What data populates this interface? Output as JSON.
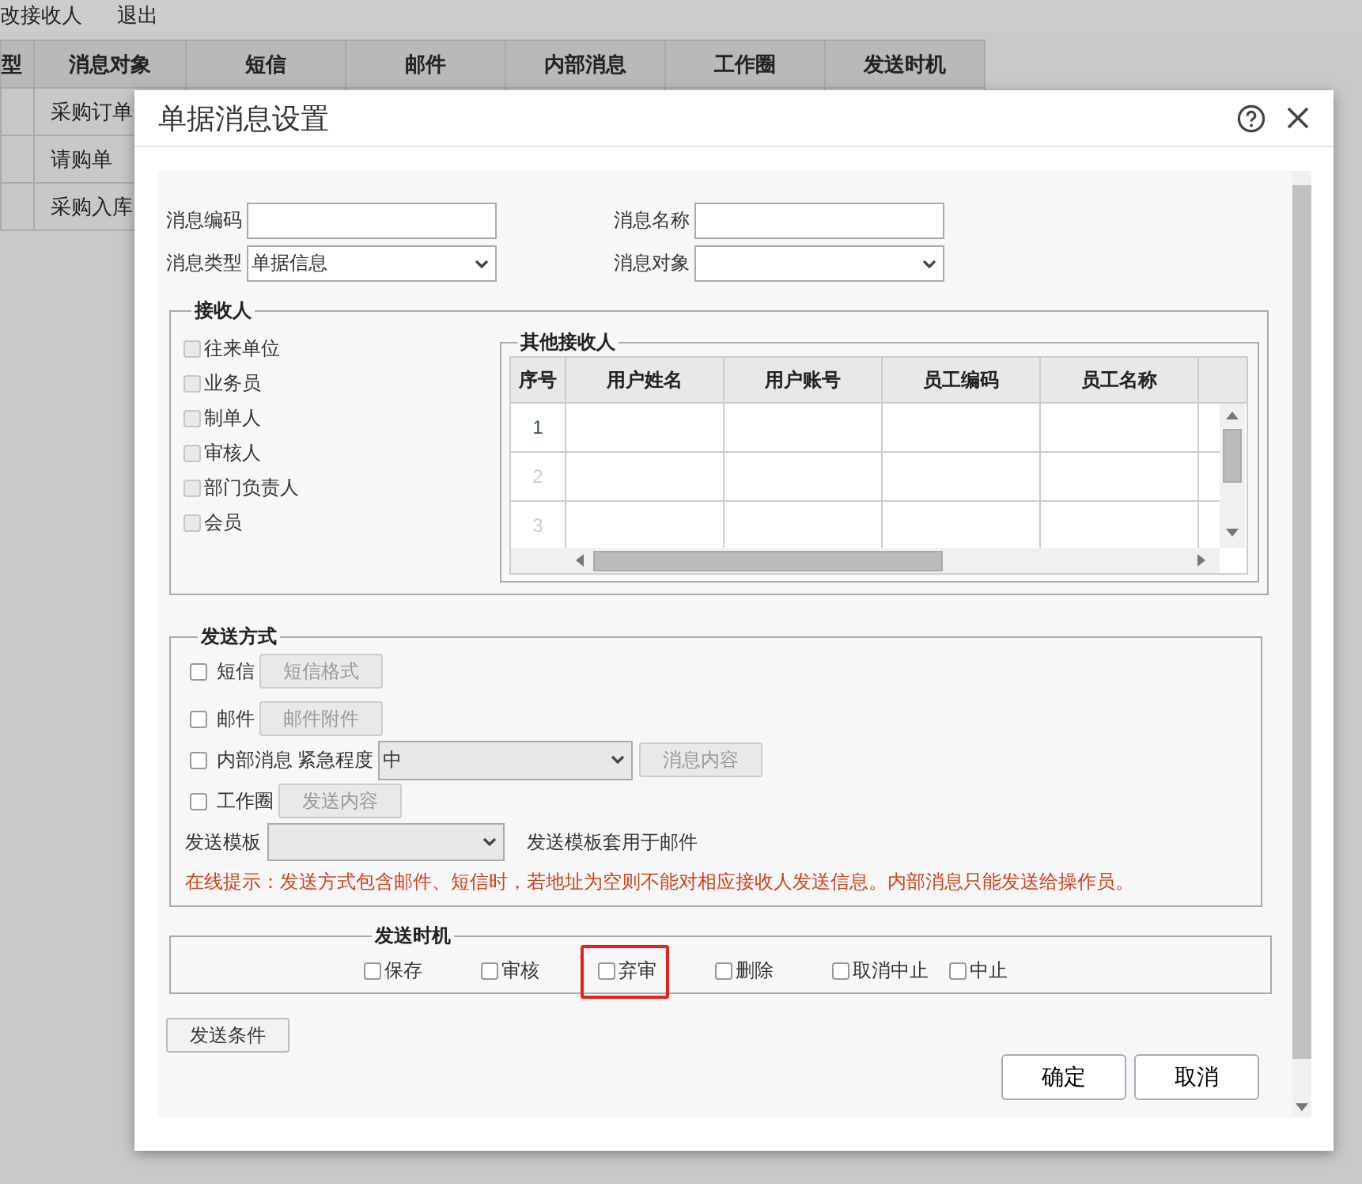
{
  "background_page": {
    "toolbar": [
      "改接收人",
      "退出"
    ],
    "table": {
      "columns": [
        "型",
        "消息对象",
        "短信",
        "邮件",
        "内部消息",
        "工作圈",
        "发送时机"
      ],
      "rows": [
        "采购订单",
        "请购单",
        "采购入库"
      ]
    }
  },
  "dialog": {
    "title": "单据消息设置",
    "fields": [
      {
        "label": "消息编码",
        "kind": "input"
      },
      {
        "label": "消息名称",
        "kind": "input"
      },
      {
        "label": "消息类型",
        "kind": "select",
        "value": "单据信息"
      },
      {
        "label": "消息对象",
        "kind": "select"
      }
    ],
    "recipients": {
      "title": "接收人",
      "options": [
        {
          "label": "往来单位",
          "checked": false,
          "disabled": true
        },
        {
          "label": "业务员",
          "checked": false,
          "disabled": true
        },
        {
          "label": "制单人",
          "checked": false,
          "disabled": true
        },
        {
          "label": "审核人",
          "checked": false,
          "disabled": true
        },
        {
          "label": "部门负责人",
          "checked": false,
          "disabled": true
        },
        {
          "label": "会员",
          "checked": false,
          "disabled": true
        }
      ],
      "others": {
        "title": "其他接收人",
        "columns": [
          "序号",
          "用户姓名",
          "用户账号",
          "员工编码",
          "员工名称"
        ],
        "rows": [
          {
            "index": "1",
            "disabled": false
          },
          {
            "index": "2",
            "disabled": true
          },
          {
            "index": "3",
            "disabled": true
          }
        ]
      }
    },
    "send_methods": {
      "title": "发送方式",
      "items": [
        {
          "label": "短信",
          "checked": false,
          "button": {
            "label": "短信格式",
            "disabled": true
          }
        },
        {
          "label": "邮件",
          "checked": false,
          "button": {
            "label": "邮件附件",
            "disabled": true
          }
        },
        {
          "label": "内部消息",
          "checked": false,
          "urgency_label": "紧急程度",
          "urgency_value": "中",
          "button": {
            "label": "消息内容",
            "disabled": true
          }
        },
        {
          "label": "工作圈",
          "checked": false,
          "button": {
            "label": "发送内容",
            "disabled": true
          }
        }
      ],
      "template_label": "发送模板",
      "template_note": "发送模板套用于邮件",
      "tip": "在线提示：发送方式包含邮件、短信时，若地址为空则不能对相应接收人发送信息。内部消息只能发送给操作员。"
    },
    "send_timing": {
      "title": "发送时机",
      "options": [
        {
          "label": "保存",
          "checked": false,
          "highlighted": false
        },
        {
          "label": "审核",
          "checked": false,
          "highlighted": false
        },
        {
          "label": "弃审",
          "checked": false,
          "highlighted": true
        },
        {
          "label": "删除",
          "checked": false,
          "highlighted": false
        },
        {
          "label": "取消中止",
          "checked": false,
          "highlighted": false
        },
        {
          "label": "中止",
          "checked": false,
          "highlighted": false
        }
      ]
    },
    "conditions_button": "发送条件",
    "buttons": [
      "确定",
      "取消"
    ]
  }
}
